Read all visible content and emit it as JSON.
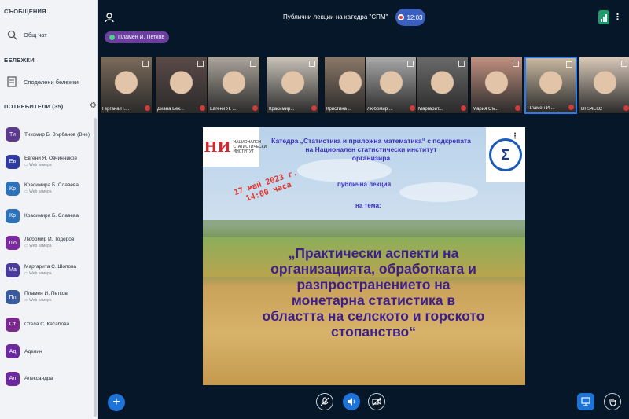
{
  "sidebar": {
    "messages_title": "СЪОБЩЕНИЯ",
    "public_chat": "Общ чат",
    "notes_title": "БЕЛЕЖКИ",
    "shared_notes": "Споделени бележки",
    "users_title": "ПОТРЕБИТЕЛИ (35)",
    "users": [
      {
        "initials": "Ти",
        "name": "Тихомир Б. Върбанов (Вие)",
        "sub": "",
        "color": "#5b3a8e"
      },
      {
        "initials": "Ев",
        "name": "Евгени Я. Овчинников",
        "sub": "Web камера",
        "color": "#2e3a9e"
      },
      {
        "initials": "Кр",
        "name": "Красимира Б. Славева",
        "sub": "Web камера",
        "color": "#2d72b8"
      },
      {
        "initials": "Кр",
        "name": "Красимира Б. Славева",
        "sub": "",
        "color": "#2d72b8"
      },
      {
        "initials": "Лю",
        "name": "Любомир И. Тодоров",
        "sub": "Web камера",
        "color": "#7a2a9e"
      },
      {
        "initials": "Ма",
        "name": "Маргарита С. Шопова",
        "sub": "Web камера",
        "color": "#4a3a9e"
      },
      {
        "initials": "Пл",
        "name": "Пламен И. Петков",
        "sub": "Web камера",
        "color": "#3a5a9e"
      },
      {
        "initials": "Ст",
        "name": "Стела С. Касабова",
        "sub": "",
        "color": "#7a2a8e"
      },
      {
        "initials": "Ад",
        "name": "Аделин",
        "sub": "",
        "color": "#6a2a9e"
      },
      {
        "initials": "Ал",
        "name": "Александра",
        "sub": "",
        "color": "#6a2a9e"
      }
    ]
  },
  "header": {
    "title": "Публични лекции на катедра \"СПМ\"",
    "timer": "12:03",
    "presenter": "Пламен И. Петков"
  },
  "participants": [
    {
      "name": "Гергана П....",
      "bg": "#7a6a5a"
    },
    {
      "name": "Диана Бек...",
      "bg": "#5a4a48"
    },
    {
      "name": "Евгени Я. ...",
      "bg": "#a9a39a"
    },
    {
      "name": "Красимир...",
      "bg": "#c8c2b8"
    },
    {
      "name": "Кристина ...",
      "bg": "#8a7868"
    },
    {
      "name": "Любомир ...",
      "bg": "#a8a8a8"
    },
    {
      "name": "Маргарит...",
      "bg": "#6a6a6a"
    },
    {
      "name": "Мария Съ...",
      "bg": "#c09080"
    },
    {
      "name": "Пламен И....",
      "bg": "#c8b8a0"
    },
    {
      "name": "DFS4ЕКС",
      "bg": "#d8c8b8"
    }
  ],
  "slide": {
    "logo_left_text": "НАЦИОНАЛЕН СТАТИСТИЧЕСКИ ИНСТИТУТ",
    "logo_left_mark": "НИ",
    "header_line1": "Катедра „Статистика и приложна математика“ с подкрепата",
    "header_line2": "на Национален статистически институт",
    "header_line3": "организира",
    "lecture": "публична лекция",
    "theme": "на тема:",
    "date_line1": "17 май 2023 г.",
    "date_line2": "14:00 часа",
    "title_line1": "„Практически аспекти на",
    "title_line2": "организацията, обработката и",
    "title_line3": "разпространението на",
    "title_line4": "монетарна статистика в",
    "title_line5": "областта на селското и горското",
    "title_line6": "стопанство“",
    "right_logo_symbol": "Σ"
  },
  "colors": {
    "accent": "#1e73d8",
    "sidebar_bg": "#f1f3f6",
    "main_bg": "#06172a",
    "slide_title": "#3d1f8c",
    "date_red": "#e0332c"
  }
}
